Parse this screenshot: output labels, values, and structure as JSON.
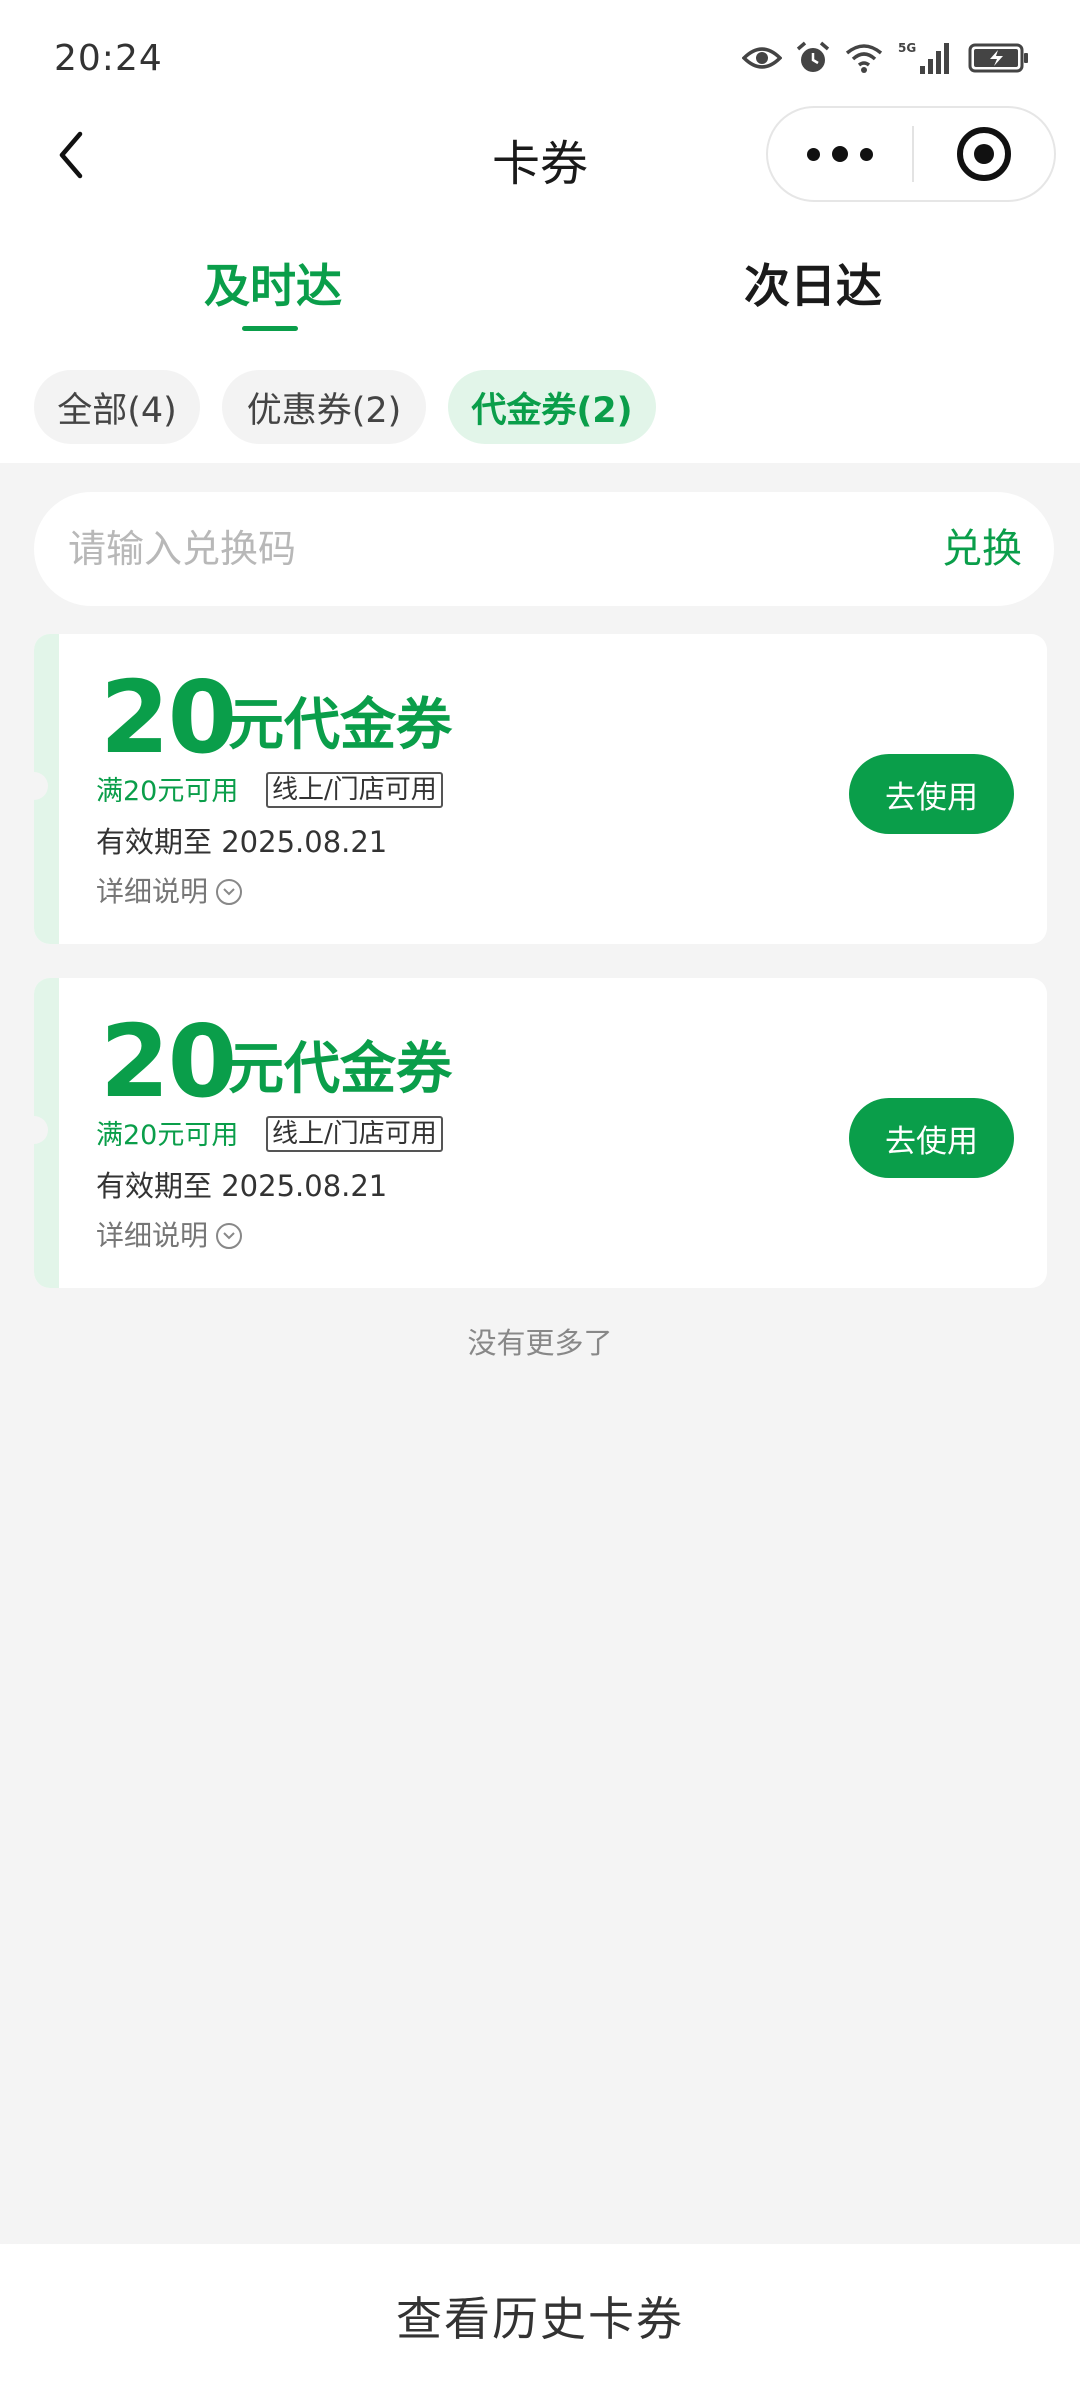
{
  "status_bar": {
    "time": "20:24",
    "icons": [
      "eye-icon",
      "alarm-icon",
      "wifi-icon",
      "signal-5g-icon",
      "battery-charging-icon"
    ],
    "network_label": "5G"
  },
  "nav": {
    "title": "卡券",
    "back_icon": "chevron-left-icon",
    "more_icon": "more-dots-icon",
    "close_icon": "target-circle-icon"
  },
  "main_tabs": [
    {
      "label": "及时达",
      "active": true
    },
    {
      "label": "次日达",
      "active": false
    }
  ],
  "filter_chips": [
    {
      "label": "全部(4)",
      "active": false
    },
    {
      "label": "优惠券(2)",
      "active": false
    },
    {
      "label": "代金券(2)",
      "active": true
    }
  ],
  "redeem": {
    "placeholder": "请输入兑换码",
    "button_label": "兑换"
  },
  "coupons": [
    {
      "amount": "20",
      "title": "元代金券",
      "condition": "满20元可用",
      "tag": "线上/门店可用",
      "expiry": "有效期至 2025.08.21",
      "detail_label": "详细说明",
      "button_label": "去使用"
    },
    {
      "amount": "20",
      "title": "元代金券",
      "condition": "满20元可用",
      "tag": "线上/门店可用",
      "expiry": "有效期至 2025.08.21",
      "detail_label": "详细说明",
      "button_label": "去使用"
    }
  ],
  "list_end_text": "没有更多了",
  "bottom": {
    "history_label": "查看历史卡券"
  },
  "colors": {
    "accent": "#0a9e4a",
    "accent_light": "#e2f5e9",
    "background": "#f4f4f4"
  }
}
